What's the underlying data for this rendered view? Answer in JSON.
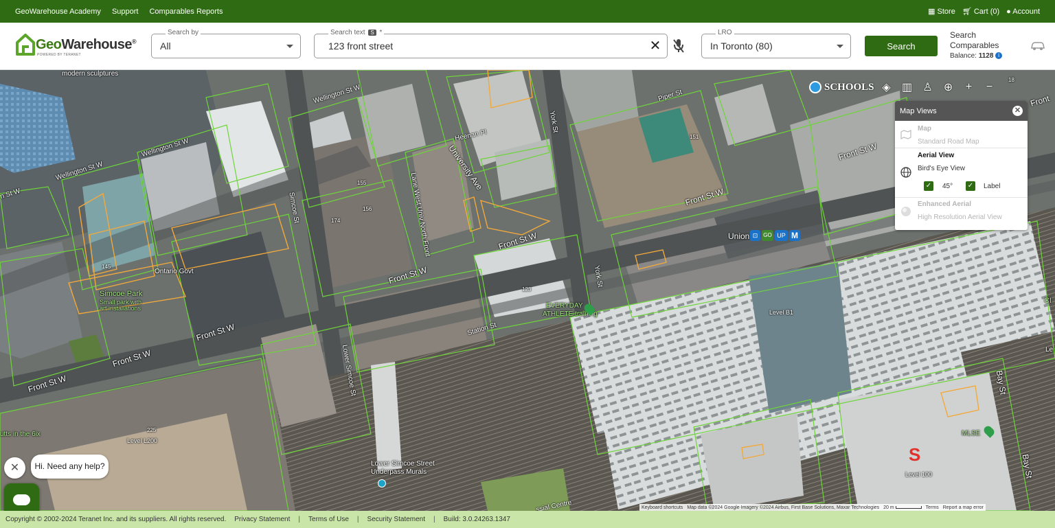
{
  "topnav": {
    "links": [
      "GeoWarehouse Academy",
      "Support",
      "Comparables Reports"
    ],
    "store": "Store",
    "cart": "Cart (0)",
    "account": "Account"
  },
  "logo": {
    "name_geo": "Geo",
    "name_rest": "Warehouse",
    "reg": "®",
    "sub": "POWERED BY TERANET"
  },
  "search_by": {
    "legend": "Search by",
    "value": "All"
  },
  "search_text": {
    "legend": "Search text",
    "badge": "S",
    "required": "*",
    "value": "123 front street",
    "clear": "✕"
  },
  "lro": {
    "legend": "LRO",
    "value": "In Toronto (80)"
  },
  "search_button": "Search",
  "comparables": {
    "line1": "Search",
    "line2": "Comparables",
    "balance_label": "Balance:",
    "balance_value": "1128",
    "info": "i"
  },
  "map": {
    "labels": {
      "wellington1": "Wellington St W",
      "wellington2": "Wellington St W",
      "wellington3": "Wellington St W",
      "wellington4": "n St W",
      "simcoe": "Simcoe St",
      "university": "University Ave",
      "heenan": "Heenan Pl",
      "lanewest": "Lane West Univ North Front",
      "york1": "York St",
      "york2": "York St",
      "piper": "Piper St",
      "front1": "Front St W",
      "front2": "Front St W",
      "front3": "Front St W",
      "front4": "Front St W",
      "front5": "Front St W",
      "front6": "Front St W",
      "front7": "Front St W",
      "frontedge": "Front",
      "ontariogovt": "Ontario Govt",
      "simcoepark": "Simcoe Park",
      "simcoepark_sub1": "Small park with",
      "simcoepark_sub2": "art installations",
      "modern": "modern sculptures",
      "union": "Union",
      "everyday1": "EVERYDAY",
      "everyday2": "ATHLETE training",
      "station": "Station St",
      "levelb1": "Level B1",
      "lowersimcoe": "Lower Simcoe St",
      "levell200": "Level L200",
      "utts": "utts in the 6ix",
      "lsm1": "Lower Simcoe Street",
      "lsm2": "Underpass Murals",
      "bay1": "Bay St",
      "bay2": "Bay St",
      "mlse": "MLSE",
      "level100": "Level 100",
      "ci": "CI",
      "le": "Le",
      "ssial": "ssial Centre",
      "n123": "123",
      "n174": "174",
      "n156": "156",
      "n155": "155",
      "n145": "145",
      "n151": "151",
      "n225": "225",
      "n18": "18"
    },
    "toolbar": {
      "schools": "SCHOOLS",
      "layers_icon": "layers-icon",
      "map_icon": "map-icon",
      "streetview_icon": "person-icon",
      "locate_icon": "crosshair-icon",
      "zoom_in": "+",
      "zoom_out": "−"
    },
    "map_views": {
      "title": "Map Views",
      "close": "✕",
      "map_title": "Map",
      "map_sub": "Standard Road Map",
      "aerial_title": "Aerial View",
      "aerial_sub": "Bird's Eye View",
      "chk_45": "45°",
      "chk_label": "Label",
      "enhanced_title": "Enhanced Aerial",
      "enhanced_sub": "High Resolution Aerial View"
    },
    "attribution": {
      "shortcuts": "Keyboard shortcuts",
      "data": "Map data ©2024 Google Imagery ©2024 Airbus, First Base Solutions, Maxar Technologies",
      "scale": "20 m",
      "terms": "Terms",
      "report": "Report a map error"
    }
  },
  "chat": {
    "close": "✕",
    "bubble": "Hi. Need any help?"
  },
  "footer": {
    "copyright": "Copyright © 2002-2024 Teranet Inc. and its suppliers. All rights reserved.",
    "privacy": "Privacy Statement",
    "terms": "Terms of Use",
    "security": "Security Statement",
    "build": "Build: 3.0.24263.1347",
    "sep": "|"
  },
  "colors": {
    "brand_green": "#2e6b12",
    "footer_green": "#c9e6a8",
    "parcel_green": "#6ed43a",
    "parcel_orange": "#f2a93b"
  }
}
